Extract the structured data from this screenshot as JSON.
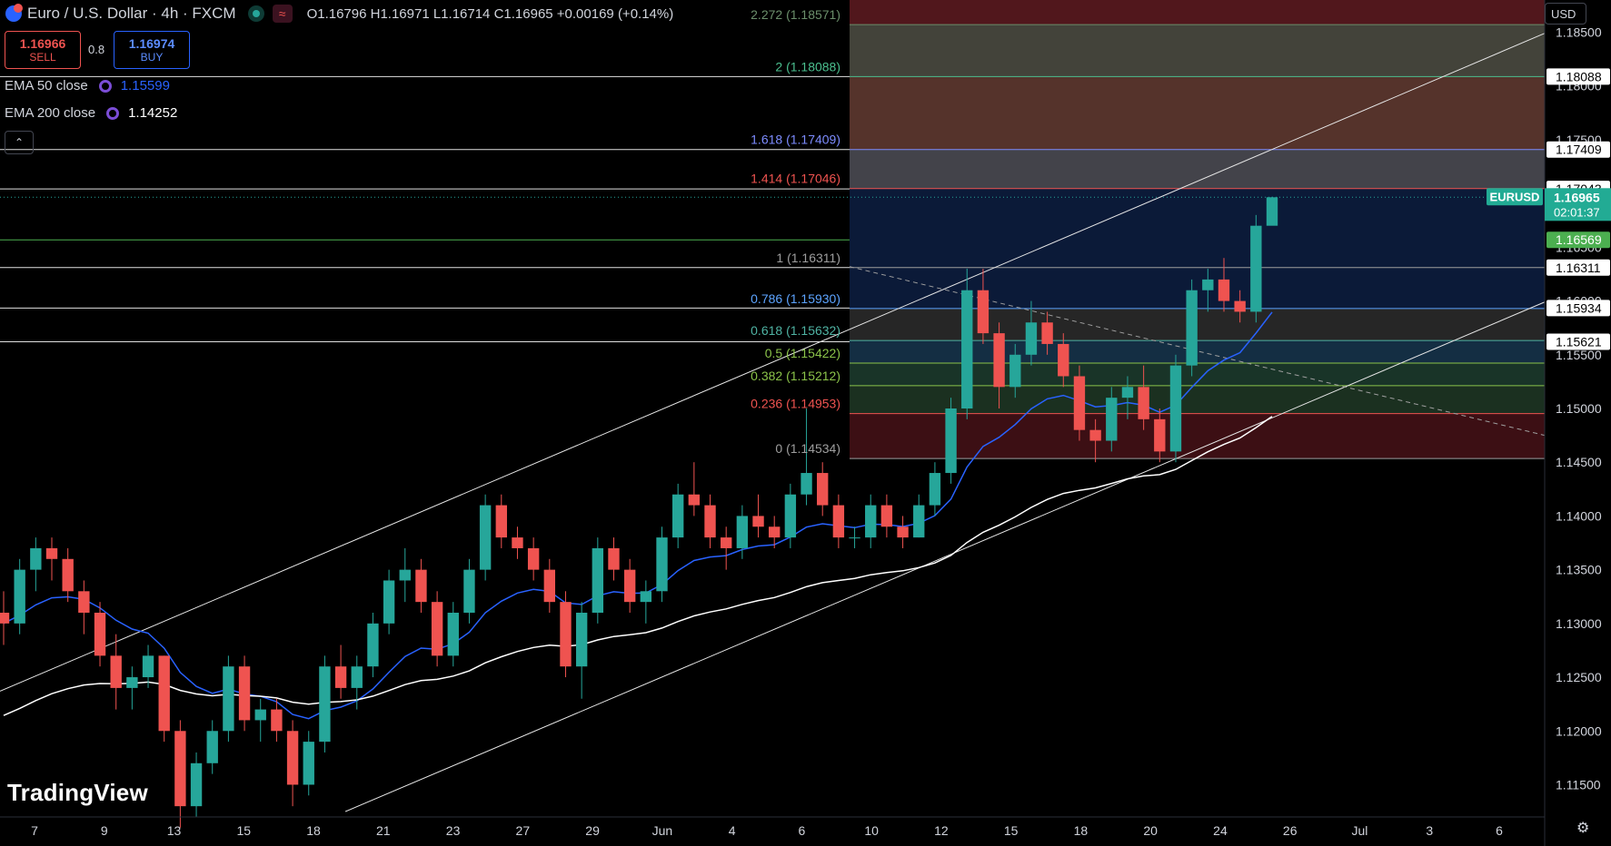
{
  "header": {
    "symbol": "Euro / U.S. Dollar · 4h · FXCM",
    "ohlc": "O1.16796  H1.16971  L1.16714  C1.16965  +0.00169 (+0.14%)",
    "wave_icon": "≈"
  },
  "trade": {
    "sell_price": "1.16966",
    "sell_label": "SELL",
    "spread": "0.8",
    "buy_price": "1.16974",
    "buy_label": "BUY"
  },
  "indicators": {
    "ema50_label": "EMA 50 close",
    "ema50_value": "1.15599",
    "ema200_label": "EMA 200 close",
    "ema200_value": "1.14252",
    "collapse_icon": "⌃"
  },
  "currency_button": "USD",
  "brand": "TradingView",
  "settings_icon": "⚙",
  "colors": {
    "background": "#000000",
    "up": "#26a69a",
    "down": "#ef5350",
    "ema50": "#2962ff",
    "ema200": "#ffffff",
    "price_tag": "#22ab94"
  },
  "chart_data": {
    "type": "candlestick",
    "symbol": "EURUSD",
    "timeframe": "4h",
    "y_axis": {
      "ticks": [
        "1.18500",
        "1.18000",
        "1.17500",
        "1.17000",
        "1.16500",
        "1.16000",
        "1.15500",
        "1.15000",
        "1.14500",
        "1.14000",
        "1.13500",
        "1.13000",
        "1.12500",
        "1.12000",
        "1.11500"
      ],
      "range": [
        1.112,
        1.188
      ]
    },
    "x_axis": {
      "ticks": [
        "7",
        "9",
        "13",
        "15",
        "18",
        "21",
        "23",
        "27",
        "29",
        "Jun",
        "4",
        "6",
        "10",
        "12",
        "15",
        "18",
        "20",
        "24",
        "26",
        "Jul",
        "3",
        "6"
      ]
    },
    "fib_levels": [
      {
        "ratio": "2.272",
        "value": "1.18571",
        "label": "2.272 (1.18571)"
      },
      {
        "ratio": "2",
        "value": "1.18088",
        "label": "2 (1.18088)"
      },
      {
        "ratio": "1.618",
        "value": "1.17409",
        "label": "1.618 (1.17409)"
      },
      {
        "ratio": "1.414",
        "value": "1.17046",
        "label": "1.414 (1.17046)"
      },
      {
        "ratio": "1",
        "value": "1.16311",
        "label": "1 (1.16311)"
      },
      {
        "ratio": "0.786",
        "value": "1.15930",
        "label": "0.786 (1.15930)"
      },
      {
        "ratio": "0.618",
        "value": "1.15632",
        "label": "0.618 (1.15632)"
      },
      {
        "ratio": "0.5",
        "value": "1.15422",
        "label": "0.5 (1.15422)"
      },
      {
        "ratio": "0.382",
        "value": "1.15212",
        "label": "0.382 (1.15212)"
      },
      {
        "ratio": "0.236",
        "value": "1.14953",
        "label": "0.236 (1.14953)"
      },
      {
        "ratio": "0",
        "value": "1.14534",
        "label": "0 (1.14534)"
      }
    ],
    "price_labels": [
      {
        "value": "1.18088",
        "style": "white"
      },
      {
        "value": "1.17409",
        "style": "white"
      },
      {
        "value": "1.17043",
        "style": "white"
      },
      {
        "value": "1.16965",
        "style": "current",
        "name": "EURUSD",
        "countdown": "02:01:37"
      },
      {
        "value": "1.16569",
        "style": "green"
      },
      {
        "value": "1.16311",
        "style": "white"
      },
      {
        "value": "1.15934",
        "style": "white"
      },
      {
        "value": "1.15621",
        "style": "white"
      }
    ],
    "last_price": 1.16965,
    "ema50_last": 1.15599,
    "ema200_last": 1.14252,
    "candles": [
      [
        1.131,
        1.133,
        1.128,
        1.13
      ],
      [
        1.13,
        1.136,
        1.129,
        1.135
      ],
      [
        1.135,
        1.138,
        1.133,
        1.137
      ],
      [
        1.137,
        1.138,
        1.134,
        1.136
      ],
      [
        1.136,
        1.137,
        1.132,
        1.133
      ],
      [
        1.133,
        1.134,
        1.129,
        1.131
      ],
      [
        1.131,
        1.132,
        1.126,
        1.127
      ],
      [
        1.127,
        1.129,
        1.122,
        1.124
      ],
      [
        1.124,
        1.126,
        1.122,
        1.125
      ],
      [
        1.125,
        1.128,
        1.124,
        1.127
      ],
      [
        1.127,
        1.127,
        1.119,
        1.12
      ],
      [
        1.12,
        1.121,
        1.111,
        1.113
      ],
      [
        1.113,
        1.118,
        1.112,
        1.117
      ],
      [
        1.117,
        1.121,
        1.116,
        1.12
      ],
      [
        1.12,
        1.127,
        1.119,
        1.126
      ],
      [
        1.126,
        1.127,
        1.12,
        1.121
      ],
      [
        1.121,
        1.123,
        1.119,
        1.122
      ],
      [
        1.122,
        1.123,
        1.119,
        1.12
      ],
      [
        1.12,
        1.121,
        1.113,
        1.115
      ],
      [
        1.115,
        1.12,
        1.114,
        1.119
      ],
      [
        1.119,
        1.127,
        1.118,
        1.126
      ],
      [
        1.126,
        1.128,
        1.123,
        1.124
      ],
      [
        1.124,
        1.127,
        1.122,
        1.126
      ],
      [
        1.126,
        1.131,
        1.125,
        1.13
      ],
      [
        1.13,
        1.135,
        1.129,
        1.134
      ],
      [
        1.134,
        1.137,
        1.132,
        1.135
      ],
      [
        1.135,
        1.136,
        1.131,
        1.132
      ],
      [
        1.132,
        1.133,
        1.126,
        1.127
      ],
      [
        1.127,
        1.132,
        1.126,
        1.131
      ],
      [
        1.131,
        1.136,
        1.13,
        1.135
      ],
      [
        1.135,
        1.142,
        1.134,
        1.141
      ],
      [
        1.141,
        1.142,
        1.137,
        1.138
      ],
      [
        1.138,
        1.139,
        1.136,
        1.137
      ],
      [
        1.137,
        1.138,
        1.134,
        1.135
      ],
      [
        1.135,
        1.136,
        1.131,
        1.132
      ],
      [
        1.132,
        1.133,
        1.125,
        1.126
      ],
      [
        1.126,
        1.132,
        1.123,
        1.131
      ],
      [
        1.131,
        1.138,
        1.13,
        1.137
      ],
      [
        1.137,
        1.138,
        1.134,
        1.135
      ],
      [
        1.135,
        1.136,
        1.131,
        1.132
      ],
      [
        1.132,
        1.134,
        1.13,
        1.133
      ],
      [
        1.133,
        1.139,
        1.132,
        1.138
      ],
      [
        1.138,
        1.143,
        1.137,
        1.142
      ],
      [
        1.142,
        1.145,
        1.14,
        1.141
      ],
      [
        1.141,
        1.142,
        1.137,
        1.138
      ],
      [
        1.138,
        1.139,
        1.135,
        1.137
      ],
      [
        1.137,
        1.141,
        1.136,
        1.14
      ],
      [
        1.14,
        1.142,
        1.138,
        1.139
      ],
      [
        1.139,
        1.14,
        1.137,
        1.138
      ],
      [
        1.138,
        1.143,
        1.137,
        1.142
      ],
      [
        1.142,
        1.15,
        1.141,
        1.144
      ],
      [
        1.144,
        1.145,
        1.14,
        1.141
      ],
      [
        1.141,
        1.142,
        1.137,
        1.138
      ],
      [
        1.138,
        1.139,
        1.137,
        1.138
      ],
      [
        1.138,
        1.142,
        1.137,
        1.141
      ],
      [
        1.141,
        1.142,
        1.138,
        1.139
      ],
      [
        1.139,
        1.14,
        1.137,
        1.138
      ],
      [
        1.138,
        1.142,
        1.138,
        1.141
      ],
      [
        1.141,
        1.145,
        1.14,
        1.144
      ],
      [
        1.144,
        1.151,
        1.143,
        1.15
      ],
      [
        1.15,
        1.163,
        1.149,
        1.161
      ],
      [
        1.161,
        1.163,
        1.156,
        1.157
      ],
      [
        1.157,
        1.158,
        1.15,
        1.152
      ],
      [
        1.152,
        1.156,
        1.151,
        1.155
      ],
      [
        1.155,
        1.16,
        1.154,
        1.158
      ],
      [
        1.158,
        1.159,
        1.155,
        1.156
      ],
      [
        1.156,
        1.157,
        1.152,
        1.153
      ],
      [
        1.153,
        1.154,
        1.147,
        1.148
      ],
      [
        1.148,
        1.149,
        1.145,
        1.147
      ],
      [
        1.147,
        1.152,
        1.146,
        1.151
      ],
      [
        1.151,
        1.153,
        1.149,
        1.152
      ],
      [
        1.152,
        1.154,
        1.148,
        1.149
      ],
      [
        1.149,
        1.15,
        1.145,
        1.146
      ],
      [
        1.146,
        1.155,
        1.145,
        1.154
      ],
      [
        1.154,
        1.162,
        1.153,
        1.161
      ],
      [
        1.161,
        1.163,
        1.159,
        1.162
      ],
      [
        1.162,
        1.164,
        1.159,
        1.16
      ],
      [
        1.16,
        1.161,
        1.158,
        1.159
      ],
      [
        1.159,
        1.168,
        1.158,
        1.167
      ],
      [
        1.167,
        1.1697,
        1.1671,
        1.16965
      ]
    ]
  }
}
